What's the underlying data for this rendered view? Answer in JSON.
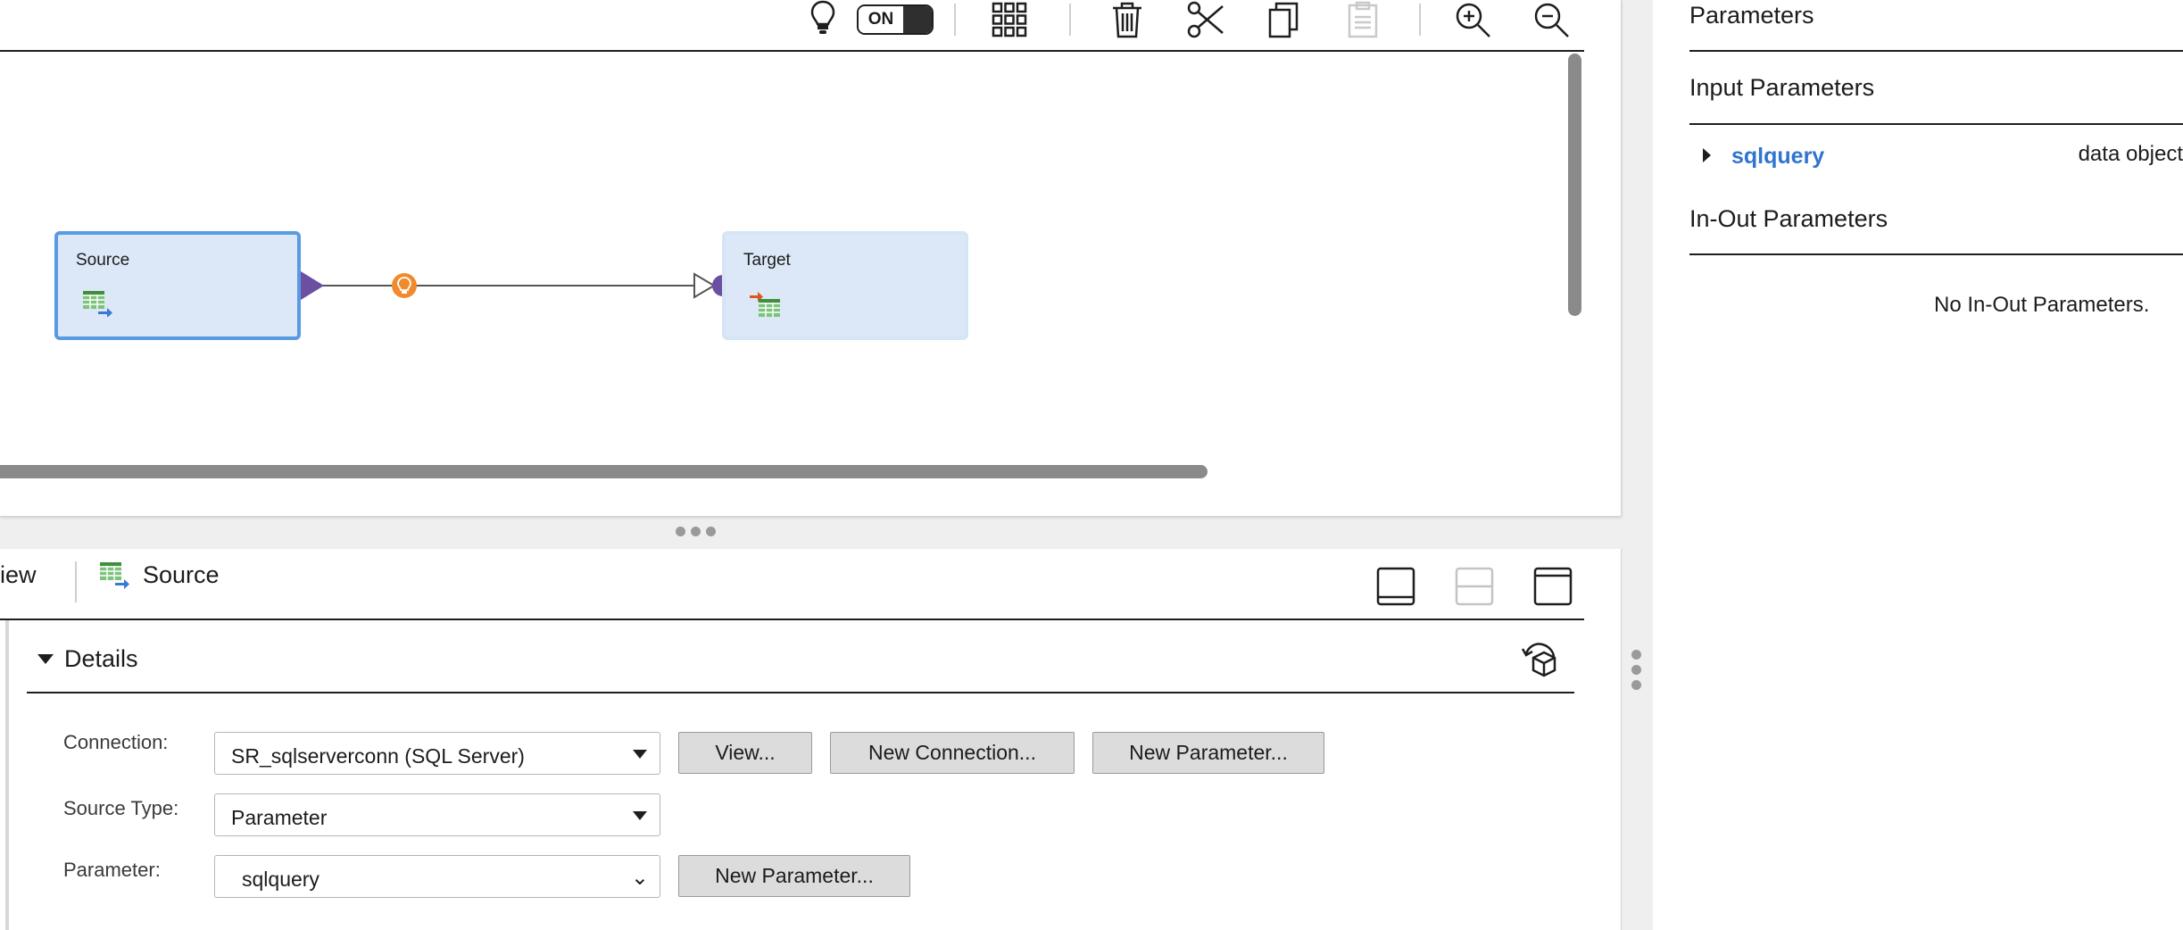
{
  "toolbar": {
    "toggle_label": "ON",
    "icons": [
      "lightbulb-icon",
      "grid-icon",
      "trash-icon",
      "scissors-icon",
      "copy-icon",
      "paste-icon",
      "zoom-in-icon",
      "zoom-out-icon"
    ]
  },
  "canvas": {
    "source_node": {
      "label": "Source",
      "icon": "source-table-icon"
    },
    "target_node": {
      "label": "Target",
      "icon": "target-table-icon"
    },
    "link_icon": "lightbulb-marker-icon",
    "colors": {
      "node_fill": "#dce8f7",
      "selected_border": "#5a9ae2",
      "link_arrow": "#6b4fa1",
      "link_marker": "#f08a2c"
    }
  },
  "properties": {
    "tab_overview_label": "iew",
    "title": "Source",
    "details": {
      "title": "Details",
      "connection": {
        "label": "Connection:",
        "value": "SR_sqlserverconn (SQL Server)"
      },
      "source_type": {
        "label": "Source Type:",
        "value": "Parameter"
      },
      "parameter": {
        "label": "Parameter:",
        "value": "sqlquery"
      },
      "buttons": {
        "view": "View...",
        "new_connection": "New Connection...",
        "new_parameter": "New Parameter...",
        "new_parameter_2": "New Parameter..."
      }
    }
  },
  "parameters_panel": {
    "title": "Parameters",
    "input_heading": "Input Parameters",
    "input_params": [
      {
        "name": "sqlquery",
        "type": "data object"
      }
    ],
    "inout_heading": "In-Out Parameters",
    "inout_empty": "No In-Out Parameters."
  }
}
